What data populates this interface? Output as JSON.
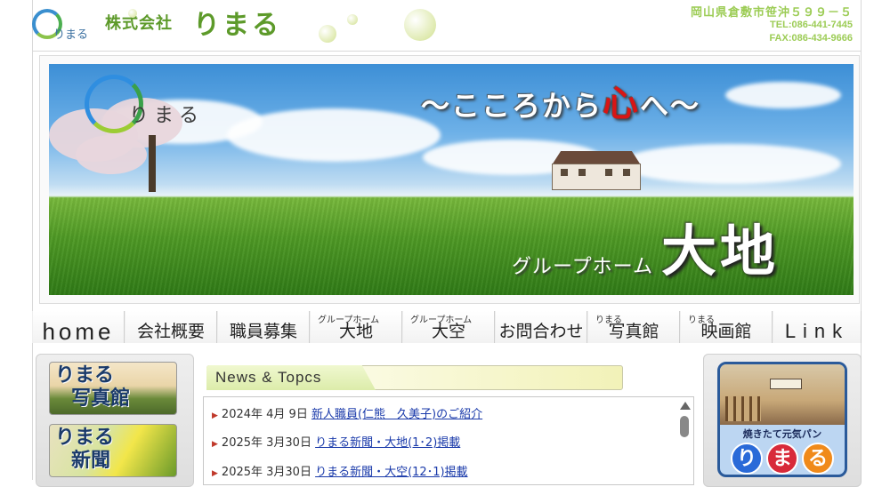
{
  "header": {
    "logo_ring_text": "りまる",
    "company_prefix": "株式会社",
    "company_name": "りまる",
    "address": "岡山県倉敷市笹沖５９９－５",
    "tel": "TEL:086-441-7445",
    "fax": "FAX:086-434-9666"
  },
  "banner": {
    "logo_text": "りまる",
    "catch_left": "～こころから",
    "catch_heart": "心",
    "catch_right": "へ～",
    "group_label": "グループホーム",
    "facility_name": "大地"
  },
  "nav": {
    "items": [
      {
        "label": "home",
        "sub": ""
      },
      {
        "label": "会社概要",
        "sub": ""
      },
      {
        "label": "職員募集",
        "sub": ""
      },
      {
        "label": "大地",
        "sub": "グループホーム"
      },
      {
        "label": "大空",
        "sub": "グループホーム"
      },
      {
        "label": "お問合わせ",
        "sub": ""
      },
      {
        "label": "写真館",
        "sub": "りまる"
      },
      {
        "label": "映画館",
        "sub": "りまる"
      },
      {
        "label": "Link",
        "sub": ""
      }
    ]
  },
  "left_banners": [
    {
      "label": "りまる\n写真館",
      "line1": "りまる",
      "line2": "写真館"
    },
    {
      "label": "りまる\n新聞",
      "line1": "りまる",
      "line2": "新聞"
    }
  ],
  "news": {
    "title": "News & Topcs",
    "items": [
      {
        "date": "2024年 4月 9日",
        "title": "新人職員(仁熊　久美子)のご紹介"
      },
      {
        "date": "2025年 3月30日",
        "title": "りまる新聞・大地(1･2)掲載"
      },
      {
        "date": "2025年 3月30日",
        "title": "りまる新聞・大空(12･1)掲載"
      }
    ]
  },
  "right_banner": {
    "caption": "焼きたて元気パン",
    "balls": [
      "り",
      "ま",
      "る"
    ],
    "ball_colors": [
      "#2a6ad8",
      "#d82a3a",
      "#f08a1a"
    ]
  },
  "colors": {
    "brand_green": "#5d9a2a",
    "address_green": "#9ccc55",
    "link_blue": "#1a3aaa",
    "nav_underline": "#a7c4a0"
  }
}
